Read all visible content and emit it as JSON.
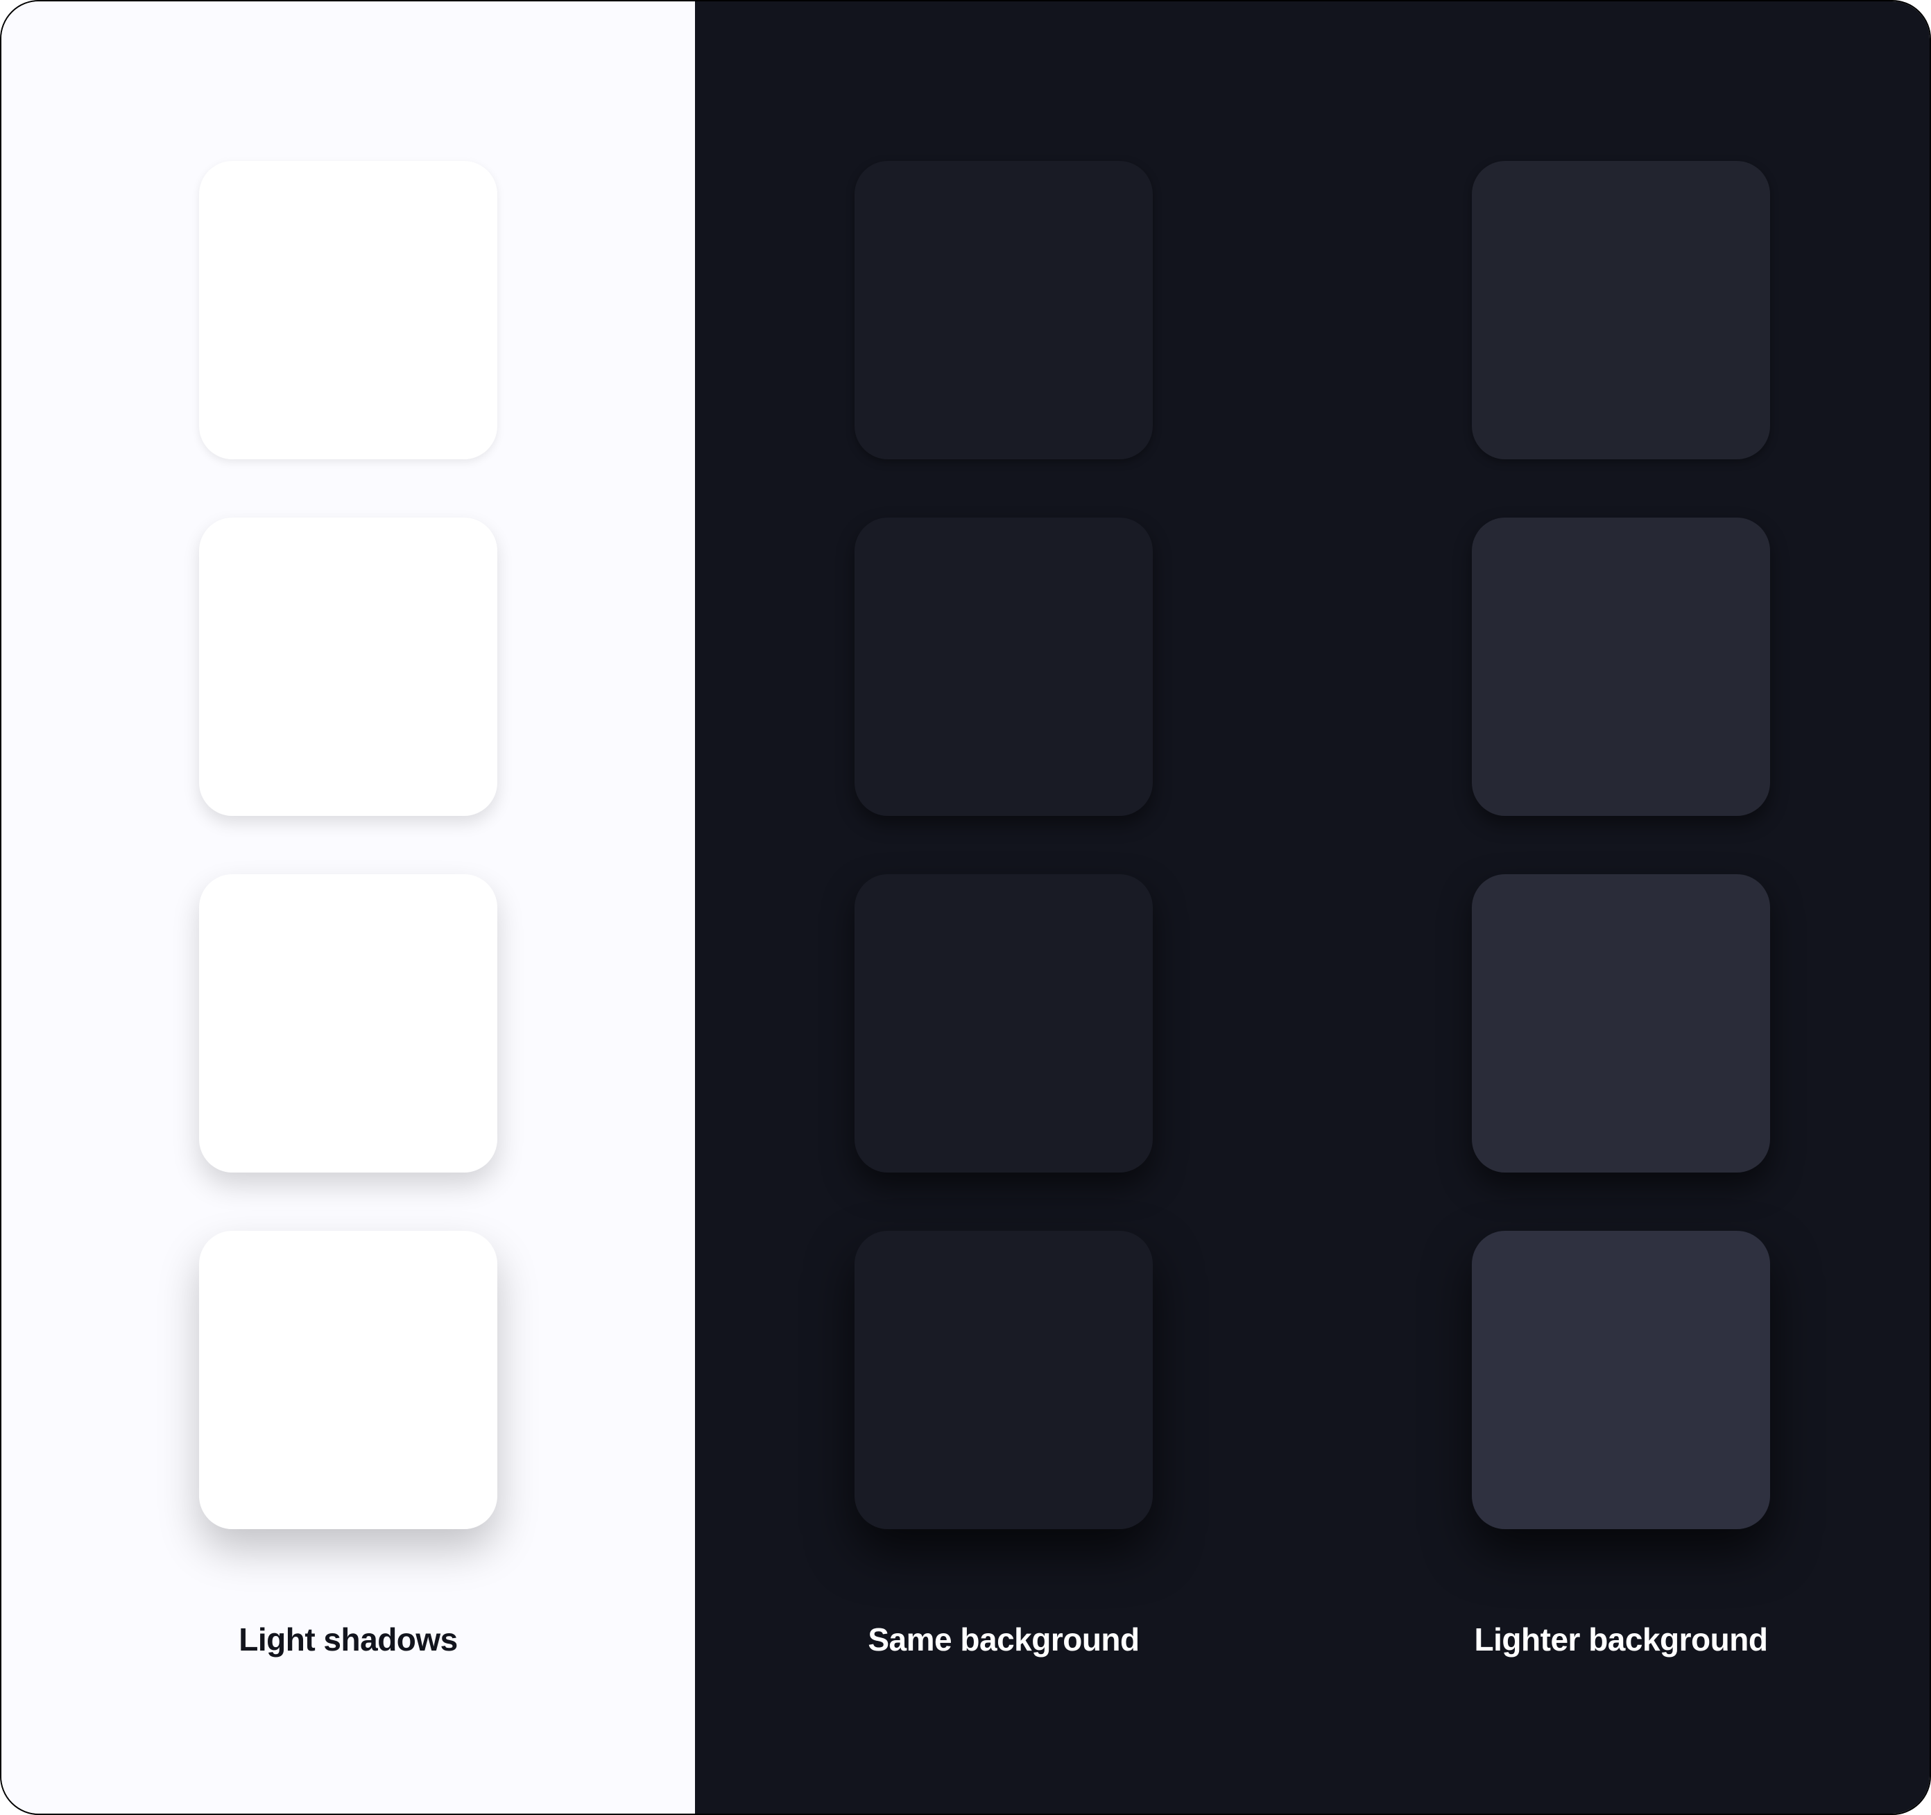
{
  "columns": [
    {
      "label": "Light shadows"
    },
    {
      "label": "Same background"
    },
    {
      "label": "Lighter background"
    }
  ],
  "colors": {
    "panel_light_bg": "#fbfbff",
    "panel_dark_bg": "#12141d",
    "swatch_light": "#ffffff",
    "swatch_same": "#191b25",
    "swatch_lighter_steps": [
      "#22242f",
      "#262834",
      "#2a2c39",
      "#2f3140"
    ]
  }
}
